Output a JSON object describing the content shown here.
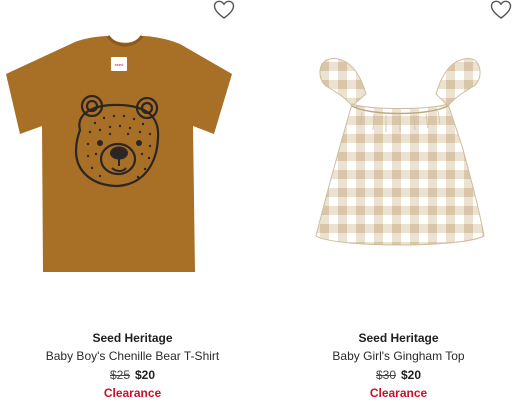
{
  "products": [
    {
      "brand": "Seed Heritage",
      "name": "Baby Boy's Chenille Bear T-Shirt",
      "original_price": "$25",
      "sale_price": "$20",
      "tag": "Clearance",
      "wishlist_icon": "heart-outline-icon",
      "label_text": "seed"
    },
    {
      "brand": "Seed Heritage",
      "name": "Baby Girl's Gingham Top",
      "original_price": "$30",
      "sale_price": "$20",
      "tag": "Clearance",
      "wishlist_icon": "heart-outline-icon"
    }
  ],
  "colors": {
    "clearance": "#c8102e",
    "tee": "#a86f26",
    "gingham": "#e2d3bb"
  }
}
